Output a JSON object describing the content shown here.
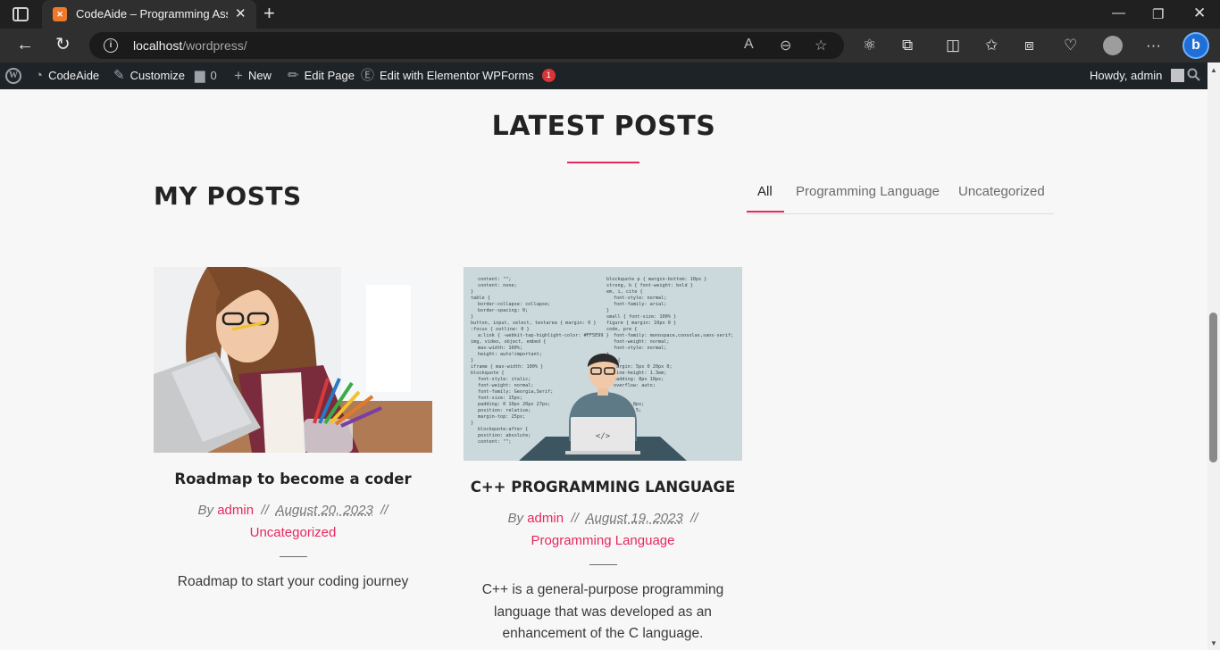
{
  "browser": {
    "tab_title": "CodeAide – Programming Assista",
    "tab_favicon": "xampp-icon",
    "url_host": "localhost",
    "url_path": "/wordpress/",
    "profile_icon": "profile-avatar-icon",
    "copilot_icon": "bing-copilot-icon"
  },
  "adminbar": {
    "site_name": "CodeAide",
    "customize": "Customize",
    "comments_count": "0",
    "new": "New",
    "edit_page": "Edit Page",
    "edit_elementor": "Edit with Elementor",
    "wpforms": "WPForms",
    "wpforms_badge": "1",
    "howdy": "Howdy, admin"
  },
  "section": {
    "heading": "LATEST POSTS",
    "subheading": "MY POSTS",
    "accent_color": "#e6285f"
  },
  "filters": [
    {
      "label": "All",
      "active": true
    },
    {
      "label": "Programming Language",
      "active": false
    },
    {
      "label": "Uncategorized",
      "active": false
    }
  ],
  "posts": [
    {
      "title": "Roadmap to become a coder",
      "by": "By",
      "author": "admin",
      "sep": "//",
      "date": "August 20, 2023",
      "category": "Uncategorized",
      "excerpt": "Roadmap to start your coding journey"
    },
    {
      "title": "C++ PROGRAMMING LANGUAGE",
      "by": "By",
      "author": "admin",
      "sep": "//",
      "date": "August 19, 2023",
      "category": "Programming Language",
      "excerpt": "C++ is a general-purpose programming language that was developed as an enhancement of the C language.",
      "image_code_lines_left": [
        "content: \"\";",
        "content: none;",
        "}",
        "table {",
        "border-collapse: collapse;",
        "border-spacing: 0;",
        "}",
        "button, input, select, textarea { margin: 0 }",
        ":focus { outline: 0 }",
        "a:link { -webkit-tap-highlight-color: #FF5E99 }",
        "img, video, object, embed {",
        "max-width: 100%;",
        "height: auto!important;",
        "}",
        "iframe { max-width: 100% }",
        "blockquote {",
        "font-style: italic;",
        "font-weight: normal;",
        "font-family: Georgia,Serif;",
        "font-size: 15px;",
        "padding: 0 10px 20px 27px;",
        "position: relative;",
        "margin-top: 25px;",
        "}",
        "blockquote:after {",
        "position: absolute;",
        "content: \"\";"
      ],
      "image_code_lines_right": [
        "blockquote p { margin-bottom: 10px }",
        "strong, b { font-weight: bold }",
        "em, i, cite {",
        "font-style: normal;",
        "font-family: arial;",
        "}",
        "small { font-size: 100% }",
        "figure { margin: 10px 0 }",
        "code, pre {",
        "font-family: monospace,consolas,sans-serif;",
        "font-weight: normal;",
        "font-style: normal;",
        "}",
        "pre {",
        "margin: 5px 0 20px 0;",
        "line-height: 1.3em;",
        "padding: 8px 10px;",
        "overflow: auto;",
        "}",
        "",
        "ing: 0 8px;",
        "ight: 1.5;",
        "",
        "",
        "1px 6px;",
        "0 2px;",
        "jx;"
      ],
      "image_laptop_label": "</>"
    }
  ]
}
